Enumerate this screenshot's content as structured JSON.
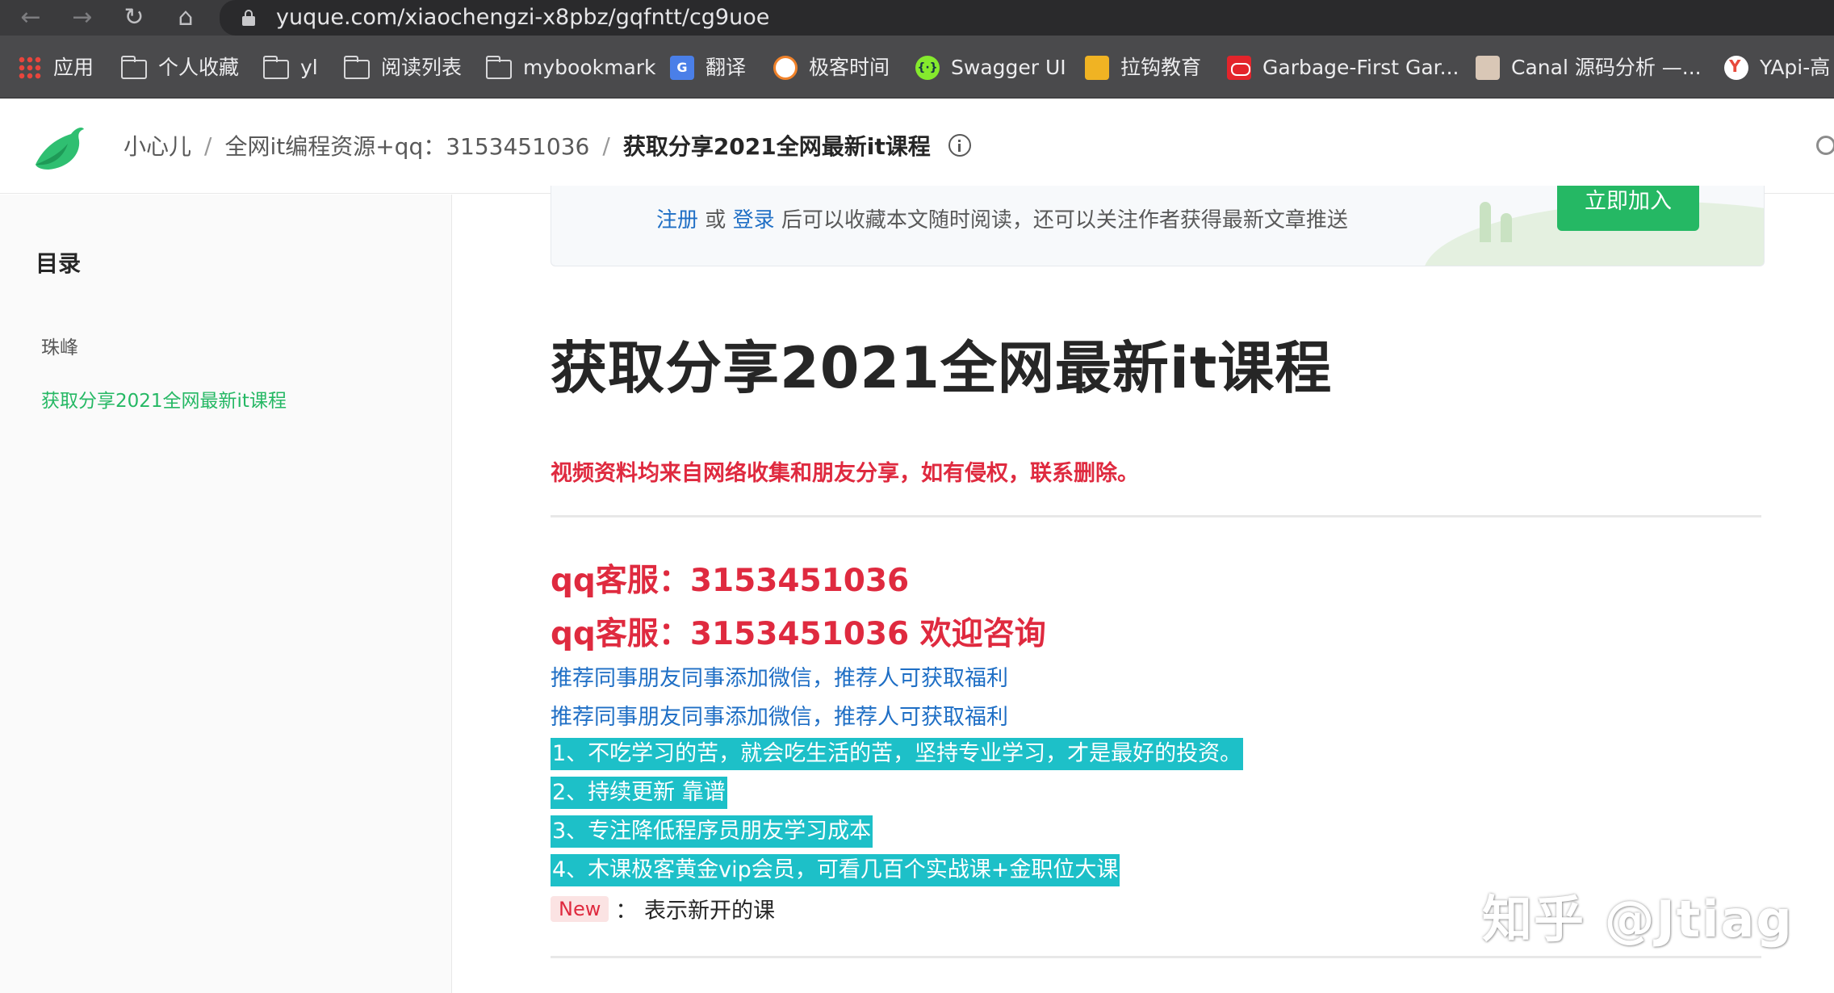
{
  "browser": {
    "url": "yuque.com/xiaochengzi-x8pbz/gqfntt/cg9uoe",
    "bookmarks": [
      {
        "label": "应用",
        "icon": "apps-grid-icon"
      },
      {
        "label": "个人收藏",
        "icon": "folder-icon"
      },
      {
        "label": "yl",
        "icon": "folder-icon"
      },
      {
        "label": "阅读列表",
        "icon": "folder-icon"
      },
      {
        "label": "mybookmark",
        "icon": "folder-icon"
      },
      {
        "label": "翻译",
        "icon": "google-translate-icon"
      },
      {
        "label": "极客时间",
        "icon": "geektime-icon"
      },
      {
        "label": "Swagger UI",
        "icon": "swagger-icon"
      },
      {
        "label": "拉钩教育",
        "icon": "lagou-icon"
      },
      {
        "label": "Garbage-First Gar...",
        "icon": "oracle-icon"
      },
      {
        "label": "Canal 源码分析 —...",
        "icon": "canal-avatar-icon"
      },
      {
        "label": "YApi-高",
        "icon": "yapi-icon"
      }
    ]
  },
  "header": {
    "breadcrumb": [
      "小心儿",
      "全网it编程资源+qq：3153451036",
      "获取分享2021全网最新it课程"
    ],
    "separator": "/"
  },
  "sidebar": {
    "title": "目录",
    "items": [
      {
        "label": "珠峰",
        "active": false
      },
      {
        "label": "获取分享2021全网最新it课程",
        "active": true
      }
    ]
  },
  "banner": {
    "register": "注册",
    "or": "或",
    "login": "登录",
    "text": "后可以收藏本文随时阅读，还可以关注作者获得最新文章推送",
    "join_button": "立即加入"
  },
  "doc": {
    "title": "获取分享2021全网最新it课程",
    "red_note": "视频资料均来自网络收集和朋友分享，如有侵权，联系删除。",
    "qq_line_1": "qq客服：3153451036",
    "qq_line_2": "qq客服：3153451036   欢迎咨询",
    "blue_line_1": "推荐同事朋友同事添加微信，推荐人可获取福利",
    "blue_line_2": "推荐同事朋友同事添加微信，推荐人可获取福利",
    "highlights": [
      "1、不吃学习的苦，就会吃生活的苦，坚持专业学习，才是最好的投资。",
      "2、持续更新 靠谱",
      "3、专注降低程序员朋友学习成本",
      "4、木课极客黄金vip会员，可看几百个实战课+金职位大课"
    ],
    "new_tag": "New",
    "new_desc": "： 表示新开的课"
  },
  "watermark": "知乎 @Jtiag",
  "colors": {
    "accent_green": "#25b864",
    "red": "#df2a3f",
    "link_blue": "#1f6fc5",
    "highlight_teal": "#1dc0c8"
  }
}
